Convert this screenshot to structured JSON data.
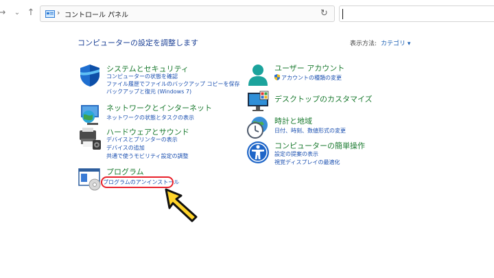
{
  "nav": {
    "address_crumb": "コントロール パネル",
    "separator": "›"
  },
  "header": {
    "title": "コンピューターの設定を調整します",
    "view_by_label": "表示方法:",
    "view_by_value": "カテゴリ ▾"
  },
  "categories": [
    {
      "title": "システムとセキュリティ",
      "icon": "shield-icon",
      "links": [
        "コンピューターの状態を確認",
        "ファイル履歴でファイルのバックアップ コピーを保存",
        "バックアップと復元 (Windows 7)"
      ]
    },
    {
      "title": "ネットワークとインターネット",
      "icon": "network-globe-icon",
      "links": [
        "ネットワークの状態とタスクの表示"
      ]
    },
    {
      "title": "ハードウェアとサウンド",
      "icon": "printer-icon",
      "links": [
        "デバイスとプリンターの表示",
        "デバイスの追加",
        "共通で使うモビリティ設定の調整"
      ]
    },
    {
      "title": "プログラム",
      "icon": "programs-icon",
      "links": [
        "プログラムのアンインストール"
      ]
    },
    {
      "title": "ユーザー アカウント",
      "icon": "user-account-icon",
      "links": [
        "アカウントの種類の変更"
      ]
    },
    {
      "title": "デスクトップのカスタマイズ",
      "icon": "desktop-monitor-icon",
      "links": []
    },
    {
      "title": "時計と地域",
      "icon": "clock-globe-icon",
      "links": [
        "日付、時刻、数値形式の変更"
      ]
    },
    {
      "title": "コンピューターの簡単操作",
      "icon": "accessibility-icon",
      "links": [
        "設定の提案の表示",
        "視覚ディスプレイの最適化"
      ]
    }
  ],
  "colors": {
    "category_title": "#1a7a2f",
    "link": "#1a4fb0",
    "highlight_ring": "#e8202a",
    "cursor_fill": "#ffd42a"
  }
}
